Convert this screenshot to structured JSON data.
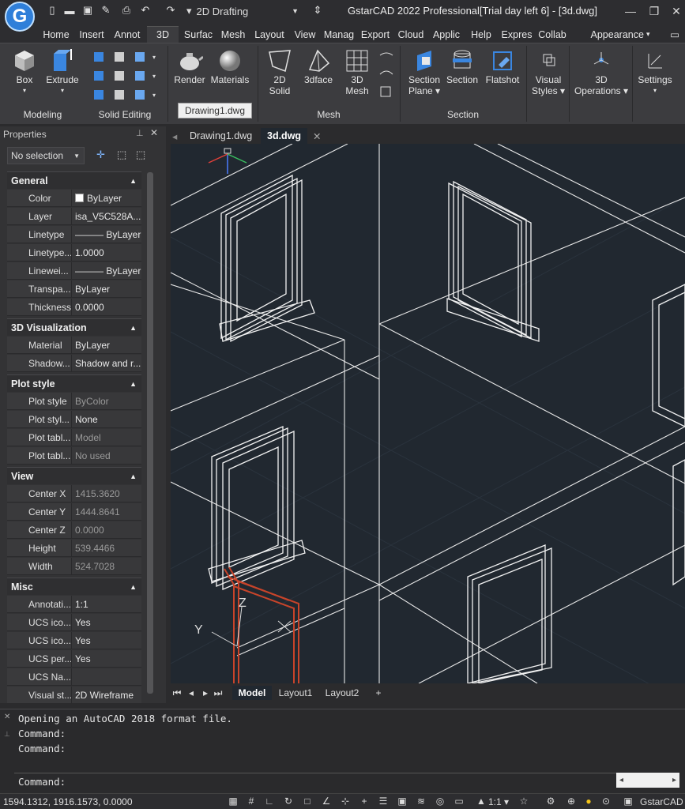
{
  "app": {
    "logo_letter": "G",
    "title": "GstarCAD 2022 Professional[Trial day left 6] - [3d.dwg]",
    "workspace": "2D Drafting",
    "accent": "#2f7fd9"
  },
  "menu_tabs": [
    "Home",
    "Insert",
    "Annot",
    "3D",
    "Surfac",
    "Mesh",
    "Layout",
    "View",
    "Manag",
    "Export",
    "Cloud",
    "Applic",
    "Help",
    "Expres",
    "Collab"
  ],
  "appearance_label": "Appearance",
  "ribbon": {
    "box": "Box",
    "extrude": "Extrude",
    "render": "Render",
    "materials": "Materials",
    "solid2d": [
      "2D",
      "Solid"
    ],
    "face3d": "3dface",
    "mesh3d": [
      "3D",
      "Mesh"
    ],
    "section_plane": [
      "Section",
      "Plane"
    ],
    "section": "Section",
    "flatshot": "Flatshot",
    "visual_styles": [
      "Visual",
      "Styles"
    ],
    "operations3d": [
      "3D",
      "Operations"
    ],
    "settings": "Settings",
    "panels": {
      "modeling": "Modeling",
      "solid_editing": "Solid Editing",
      "mesh": "Mesh",
      "section": "Section"
    },
    "tooltip": "Drawing1.dwg"
  },
  "properties": {
    "header": "Properties",
    "selection": "No selection",
    "general": {
      "title": "General",
      "rows": [
        [
          "Color",
          "ByLayer"
        ],
        [
          "Layer",
          "isa_V5C528A..."
        ],
        [
          "Linetype",
          "——— ByLayer"
        ],
        [
          "Linetype...",
          "1.0000"
        ],
        [
          "Linewei...",
          "——— ByLayer"
        ],
        [
          "Transpa...",
          "ByLayer"
        ],
        [
          "Thickness",
          "0.0000"
        ]
      ]
    },
    "vis3d": {
      "title": "3D Visualization",
      "rows": [
        [
          "Material",
          "ByLayer"
        ],
        [
          "Shadow...",
          "Shadow and r..."
        ]
      ]
    },
    "plot": {
      "title": "Plot style",
      "rows": [
        [
          "Plot style",
          "ByColor"
        ],
        [
          "Plot styl...",
          "None"
        ],
        [
          "Plot tabl...",
          "Model"
        ],
        [
          "Plot tabl...",
          "No used"
        ]
      ]
    },
    "view": {
      "title": "View",
      "rows": [
        [
          "Center X",
          "1415.3620"
        ],
        [
          "Center Y",
          "1444.8641"
        ],
        [
          "Center Z",
          "0.0000"
        ],
        [
          "Height",
          "539.4466"
        ],
        [
          "Width",
          "524.7028"
        ]
      ]
    },
    "misc": {
      "title": "Misc",
      "rows": [
        [
          "Annotati...",
          "1:1"
        ],
        [
          "UCS ico...",
          "Yes"
        ],
        [
          "UCS ico...",
          "Yes"
        ],
        [
          "UCS per...",
          "Yes"
        ],
        [
          "UCS Na...",
          ""
        ],
        [
          "Visual st...",
          "2D Wireframe"
        ]
      ]
    }
  },
  "doc_tabs": [
    "Drawing1.dwg",
    "3d.dwg"
  ],
  "viewport_labels": {
    "ucs_y": "Y",
    "ucs_z": "Z"
  },
  "layout_tabs": [
    "Model",
    "Layout1",
    "Layout2",
    "+"
  ],
  "command": {
    "lines": [
      "Opening an AutoCAD 2018 format file.",
      "Command:",
      "Command:"
    ],
    "prompt": "Command:"
  },
  "status": {
    "coords": "1594.1312, 1916.1573, 0.0000",
    "scale": "1:1",
    "brand": "GstarCAD"
  }
}
